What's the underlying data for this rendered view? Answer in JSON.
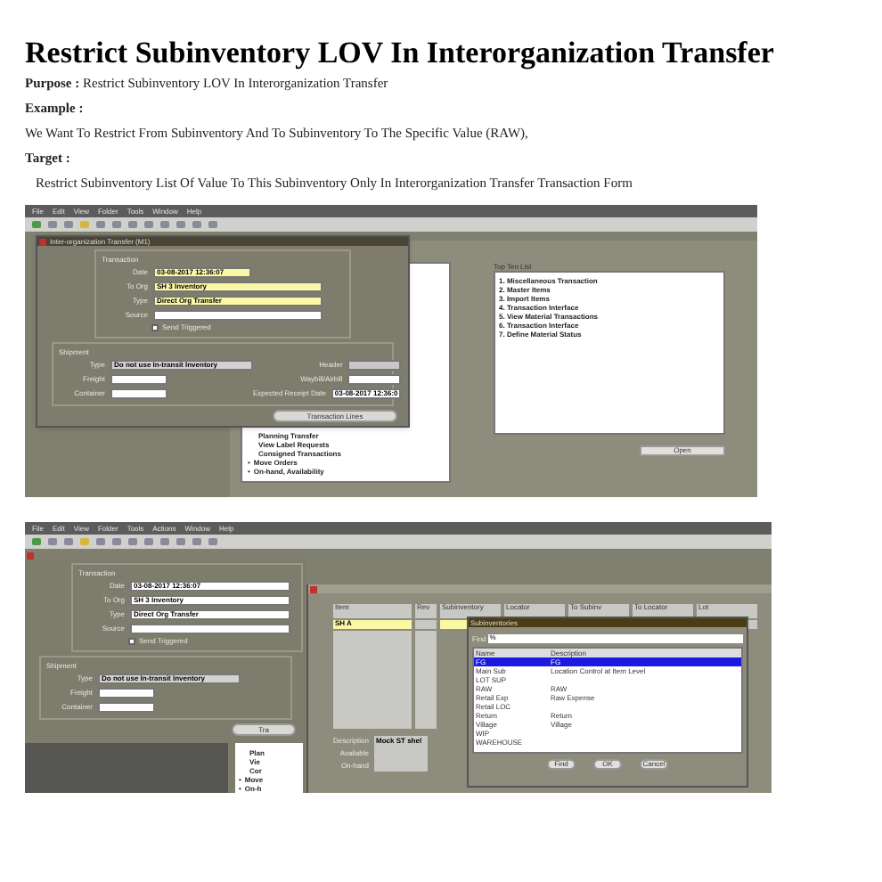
{
  "document": {
    "title": "Restrict Subinventory LOV In Interorganization Transfer",
    "purpose": {
      "label": "Purpose :",
      "text": "Restrict Subinventory LOV In Interorganization Transfer"
    },
    "example": {
      "label": "Example :",
      "text": "We Want To Restrict From Subinventory And To Subinventory To The Specific Value (RAW),"
    },
    "target": {
      "label": "Target :",
      "text": "Restrict Subinventory List Of Value To This Subinventory Only In Interorganization Transfer Transaction Form"
    }
  },
  "screenshot_1": {
    "menu": [
      "File",
      "Edit",
      "View",
      "Folder",
      "Tools",
      "Window",
      "Help"
    ],
    "window_title": "Inter-organization Transfer (M1)",
    "transaction": {
      "legend": "Transaction",
      "fields": [
        {
          "label": "Date",
          "value": "03-08-2017 12:36:07",
          "required": true
        },
        {
          "label": "To Org",
          "value": "SH 3 Inventory",
          "required": true
        },
        {
          "label": "Type",
          "value": "Direct Org Transfer",
          "required": true
        },
        {
          "label": "Source",
          "required": false
        }
      ]
    },
    "checkbox": {
      "label": "Send Triggered",
      "checked": false
    },
    "shipment": {
      "legend": "Shipment",
      "type_label": "Type",
      "type_value": "Do not use In-transit Inventory",
      "freight_label": "Freight",
      "container_label": "Container",
      "header_label": "Header",
      "waybill_label": "Waybill/Airbill",
      "receipt_label": "Expected Receipt Date",
      "receipt_value": "03-08-2017 12:36:0"
    },
    "lines_button": "Transaction Lines",
    "navigator_items": [
      {
        "text": "Planning Transfer"
      },
      {
        "text": "View Label Requests"
      },
      {
        "text": "Consigned Transactions"
      },
      {
        "marker": "•",
        "text": "Move Orders"
      },
      {
        "marker": "•",
        "text": "On-hand, Availability"
      }
    ],
    "top_ten": {
      "title": "Top Ten List",
      "items": [
        "1. Miscellaneous Transaction",
        "2. Master Items",
        "3. Import Items",
        "4. Transaction Interface",
        "5. View Material Transactions",
        "6. Transaction Interface",
        "7. Define Material Status"
      ]
    },
    "open_button": "Open"
  },
  "screenshot_2": {
    "menu": [
      "File",
      "Edit",
      "View",
      "Folder",
      "Tools",
      "Actions",
      "Window",
      "Help"
    ],
    "transaction": {
      "legend": "Transaction",
      "fields": [
        {
          "label": "Date",
          "value": "03-08-2017 12:36:07"
        },
        {
          "label": "To Org",
          "value": "SH 3 Inventory"
        },
        {
          "label": "Type",
          "value": "Direct Org Transfer"
        },
        {
          "label": "Source"
        }
      ]
    },
    "checkbox": {
      "label": "Send Triggered",
      "checked": false
    },
    "shipment": {
      "legend": "Shipment",
      "type_label": "Type",
      "type_value": "Do not use In-transit Inventory",
      "freight_label": "Freight",
      "container_label": "Container"
    },
    "lines_button": "Tra",
    "navigator_items": [
      {
        "text": "Plan"
      },
      {
        "text": "Vie"
      },
      {
        "text": "Cor"
      },
      {
        "marker": "•",
        "text": "Move"
      },
      {
        "marker": "•",
        "text": "On-h"
      }
    ],
    "lines": {
      "columns": [
        "Item",
        "Rev",
        "Subinventory",
        "Locator",
        "To Subinv",
        "To Locator",
        "Lot"
      ],
      "first_item": "SH A",
      "description_label": "Description",
      "description_value": "Mock ST shel",
      "available_label": "Available",
      "onhand_label": "On-hand"
    },
    "lov": {
      "title": "Subinventories",
      "find_label": "Find",
      "find_value": "%",
      "columns": [
        "Name",
        "Description"
      ],
      "rows": [
        {
          "name": "FG",
          "description": "FG",
          "selected": true
        },
        {
          "name": "Main Sub",
          "description": "Location Control at Item Level",
          "selected": false
        },
        {
          "name": "LOT SUP",
          "selected": false
        },
        {
          "name": "RAW",
          "description": "RAW",
          "selected": false
        },
        {
          "name": "Retail Exp",
          "description": "Raw Expense",
          "selected": false
        },
        {
          "name": "Retail LOC",
          "selected": false
        },
        {
          "name": "Return",
          "description": "Return",
          "selected": false
        },
        {
          "name": "Village",
          "description": "Village",
          "selected": false
        },
        {
          "name": "WIP",
          "selected": false
        },
        {
          "name": "WAREHOUSE",
          "selected": false
        }
      ],
      "buttons": [
        "Find",
        "OK",
        "Cancel"
      ]
    }
  }
}
